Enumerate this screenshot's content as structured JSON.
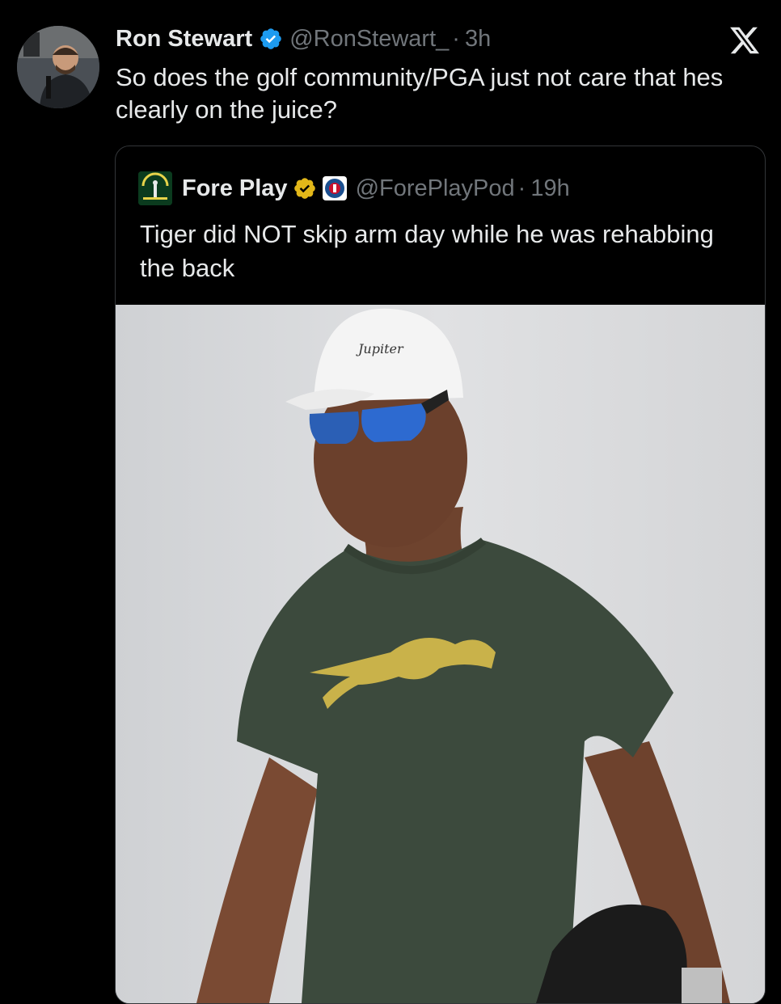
{
  "tweet": {
    "author_name": "Ron Stewart",
    "handle": "@RonStewart_",
    "separator": "·",
    "time": "3h",
    "text": "So does the golf community/PGA just not care that hes clearly on the juice?",
    "verified_icon": "blue-verified-badge",
    "platform_icon": "x-logo"
  },
  "quoted_tweet": {
    "author_name": "Fore Play",
    "handle": "@ForePlayPod",
    "separator": "·",
    "time": "19h",
    "text": "Tiger did NOT skip arm day while he was rehabbing the back",
    "verified_icon": "gold-verified-badge",
    "affiliate_icon": "barstool-badge",
    "avatar_logo_text": "FORE PLAY",
    "image_description_icon": "photo-of-golfer-in-green-shirt"
  },
  "colors": {
    "background": "#000000",
    "text_primary": "#e7e9ea",
    "text_secondary": "#71767b",
    "verified_blue": "#1d9bf0",
    "verified_gold": "#e2b719",
    "border": "#333639",
    "shirt_green": "#3c4a3d",
    "logo_gold": "#c9b24a"
  }
}
